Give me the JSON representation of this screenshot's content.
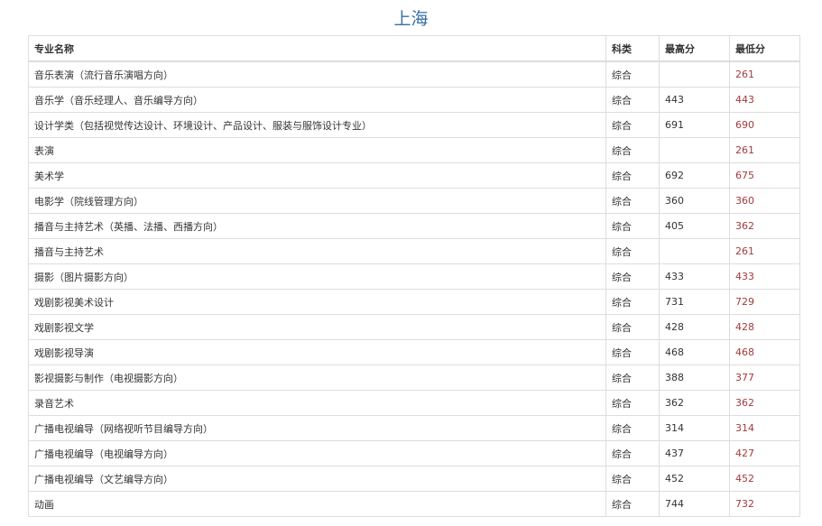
{
  "title": "上海",
  "table": {
    "headers": {
      "name": "专业名称",
      "type": "科类",
      "high": "最高分",
      "low": "最低分"
    },
    "rows": [
      {
        "name": "音乐表演（流行音乐演唱方向）",
        "type": "综合",
        "high": "",
        "low": "261"
      },
      {
        "name": "音乐学（音乐经理人、音乐编导方向）",
        "type": "综合",
        "high": "443",
        "low": "443"
      },
      {
        "name": "设计学类（包括视觉传达设计、环境设计、产品设计、服装与服饰设计专业）",
        "type": "综合",
        "high": "691",
        "low": "690"
      },
      {
        "name": "表演",
        "type": "综合",
        "high": "",
        "low": "261"
      },
      {
        "name": "美术学",
        "type": "综合",
        "high": "692",
        "low": "675"
      },
      {
        "name": "电影学（院线管理方向）",
        "type": "综合",
        "high": "360",
        "low": "360"
      },
      {
        "name": "播音与主持艺术（英播、法播、西播方向）",
        "type": "综合",
        "high": "405",
        "low": "362"
      },
      {
        "name": "播音与主持艺术",
        "type": "综合",
        "high": "",
        "low": "261"
      },
      {
        "name": "摄影（图片摄影方向）",
        "type": "综合",
        "high": "433",
        "low": "433"
      },
      {
        "name": "戏剧影视美术设计",
        "type": "综合",
        "high": "731",
        "low": "729"
      },
      {
        "name": "戏剧影视文学",
        "type": "综合",
        "high": "428",
        "low": "428"
      },
      {
        "name": "戏剧影视导演",
        "type": "综合",
        "high": "468",
        "low": "468"
      },
      {
        "name": "影视摄影与制作（电视摄影方向）",
        "type": "综合",
        "high": "388",
        "low": "377"
      },
      {
        "name": "录音艺术",
        "type": "综合",
        "high": "362",
        "low": "362"
      },
      {
        "name": "广播电视编导（网络视听节目编导方向）",
        "type": "综合",
        "high": "314",
        "low": "314"
      },
      {
        "name": "广播电视编导（电视编导方向）",
        "type": "综合",
        "high": "437",
        "low": "427"
      },
      {
        "name": "广播电视编导（文艺编导方向）",
        "type": "综合",
        "high": "452",
        "low": "452"
      },
      {
        "name": "动画",
        "type": "综合",
        "high": "744",
        "low": "732"
      }
    ]
  }
}
